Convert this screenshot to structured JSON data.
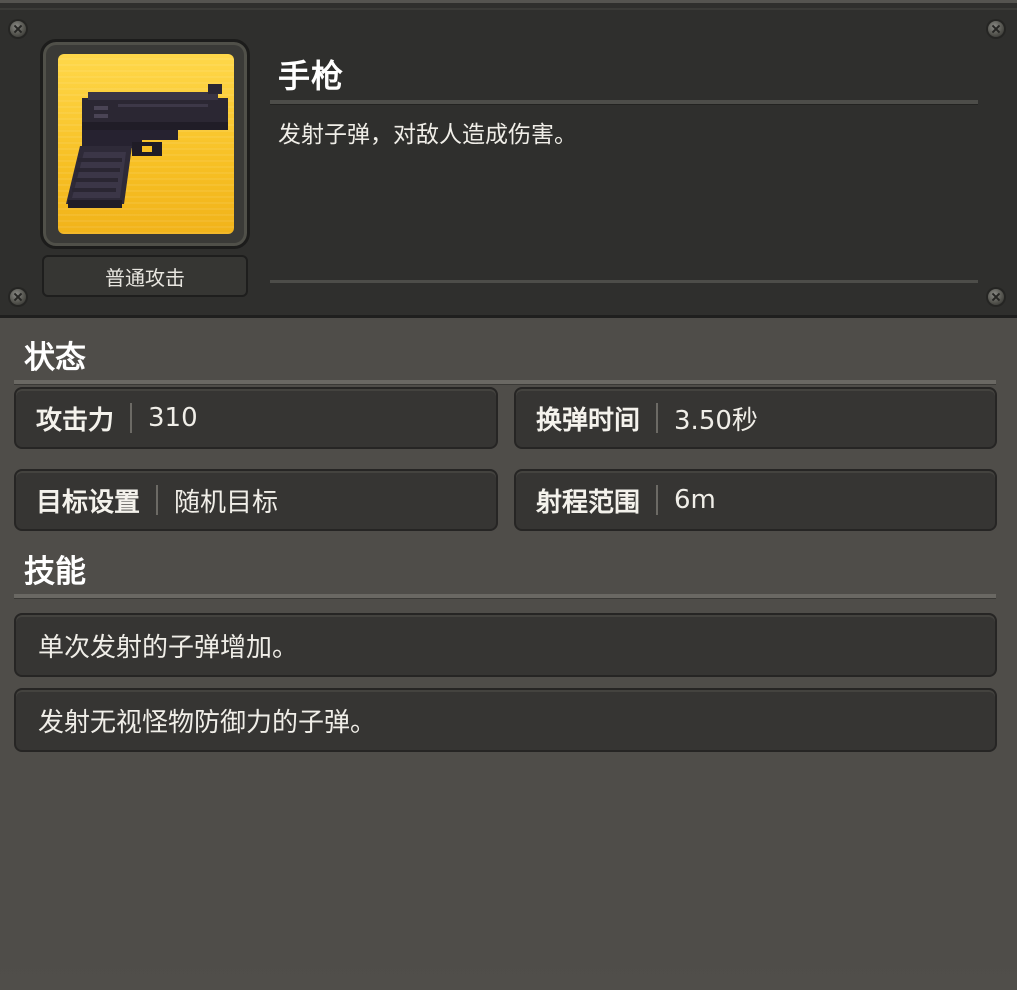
{
  "weapon": {
    "name": "手枪",
    "description": "发射子弹，对敌人造成伤害。",
    "attack_type": "普通攻击",
    "icon": "pistol-icon",
    "icon_bg_color": "#f7c024"
  },
  "status": {
    "title": "状态",
    "stats": [
      {
        "label": "攻击力",
        "value": "310"
      },
      {
        "label": "换弹时间",
        "value": "3.50秒"
      },
      {
        "label": "目标设置",
        "value": "随机目标"
      },
      {
        "label": "射程范围",
        "value": "6m"
      }
    ]
  },
  "skills": {
    "title": "技能",
    "items": [
      "单次发射的子弹增加。",
      "发射无视怪物防御力的子弹。"
    ]
  }
}
